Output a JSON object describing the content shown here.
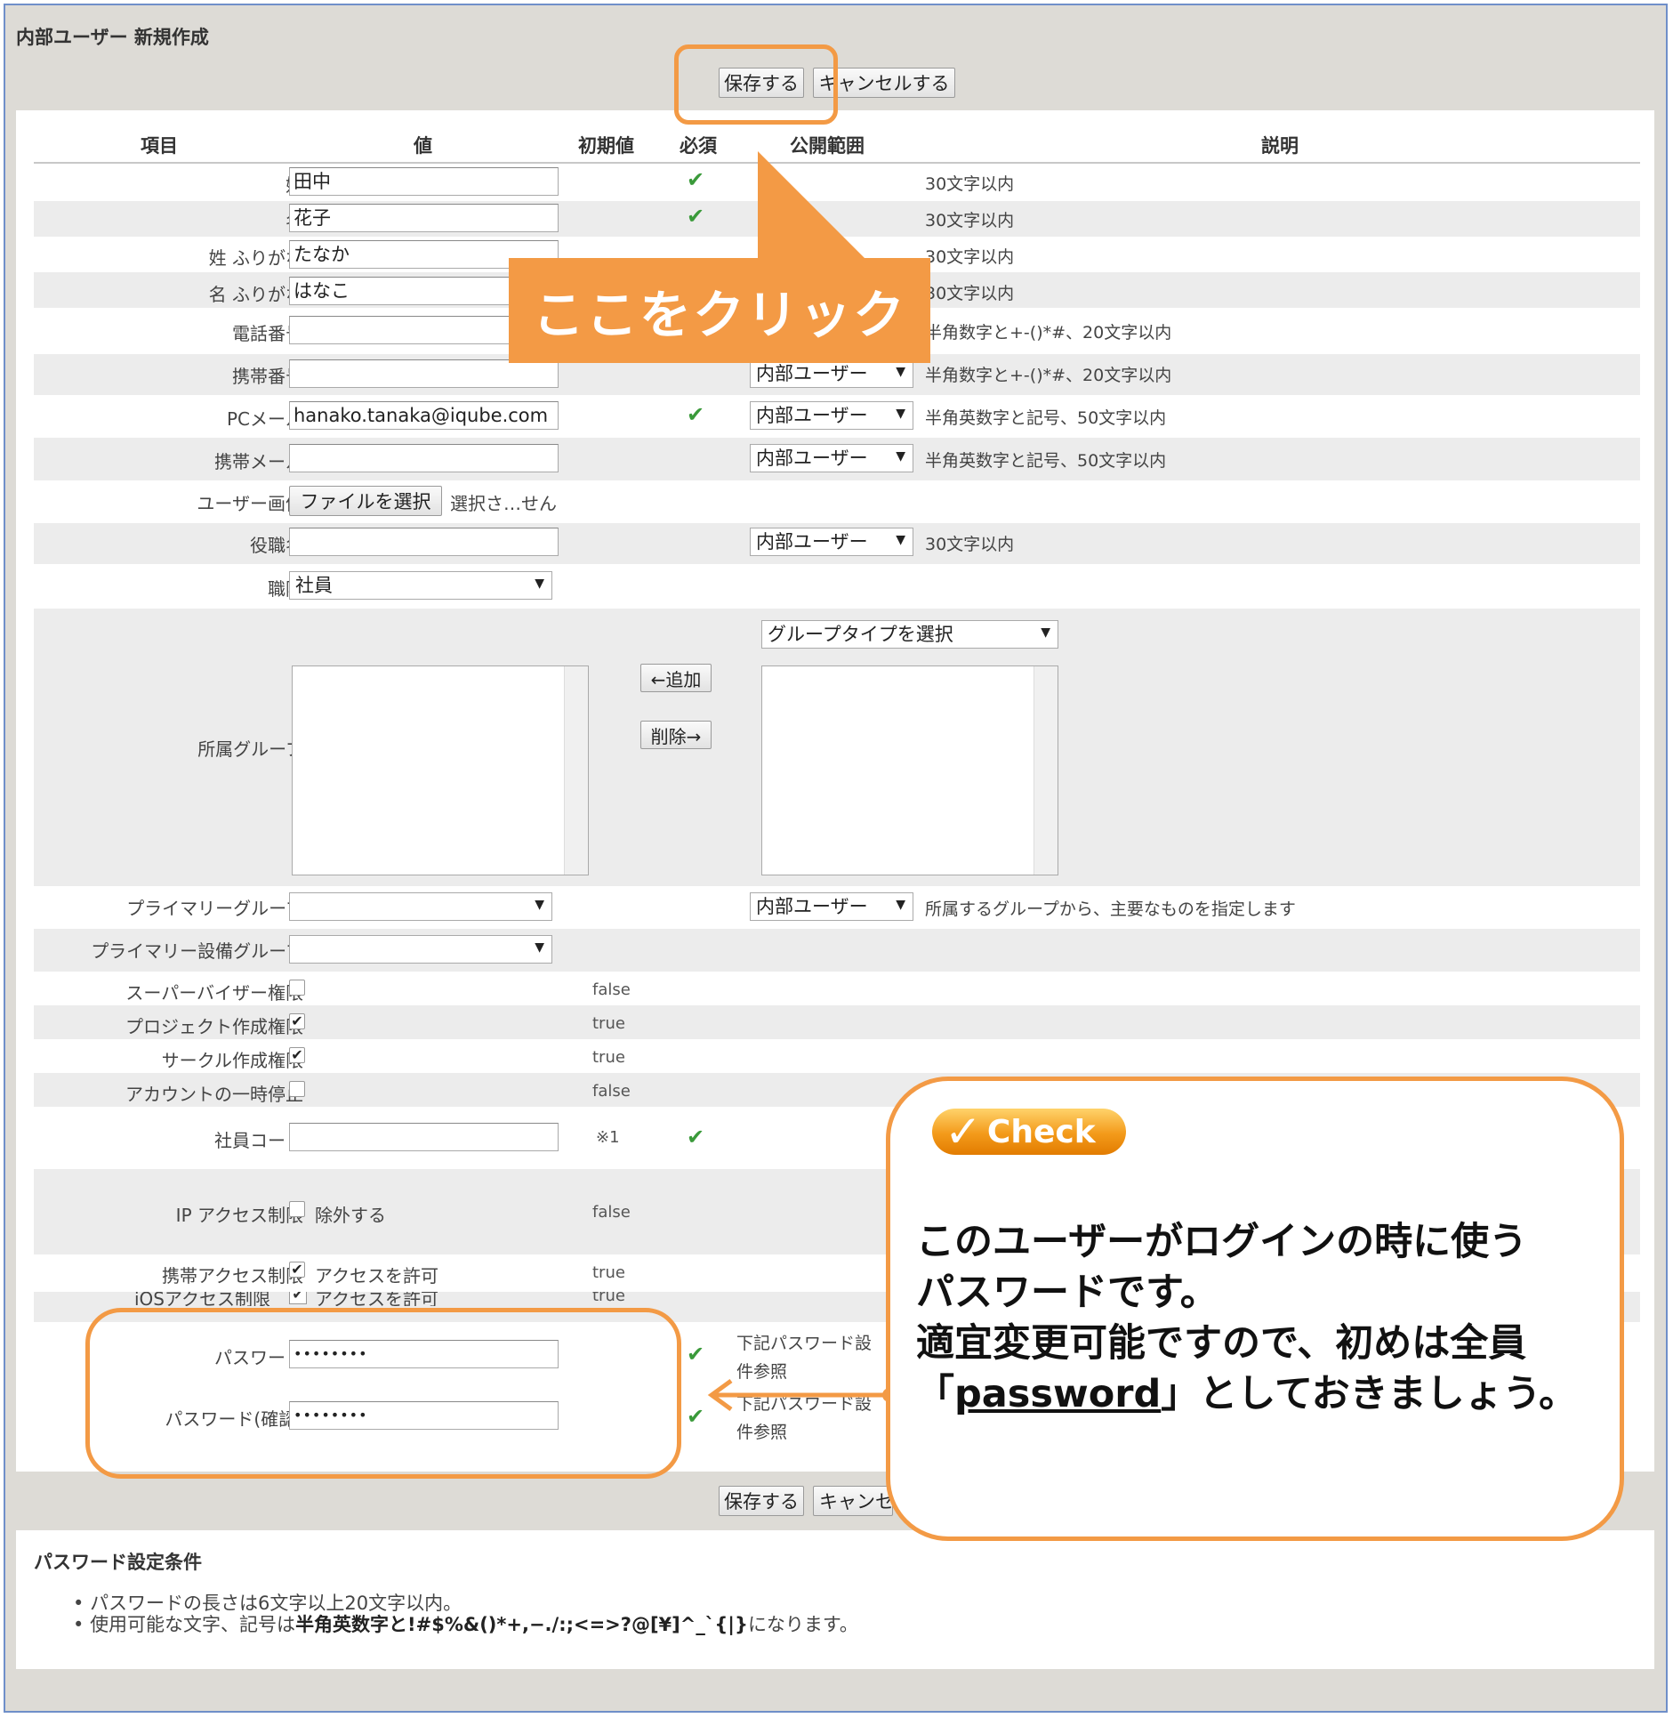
{
  "page": {
    "title": "内部ユーザー 新規作成"
  },
  "toolbar": {
    "save_label": "保存する",
    "cancel_label": "キャンセルする",
    "cancel_label_partial": "キャンセ"
  },
  "columns": {
    "item": "項目",
    "value": "値",
    "default": "初期値",
    "required": "必須",
    "visibility": "公開範囲",
    "description": "説明"
  },
  "fields": {
    "last_name": {
      "label": "姓",
      "value": "田中",
      "desc": "30文字以内"
    },
    "first_name": {
      "label": "名",
      "value": "花子",
      "desc": "30文字以内"
    },
    "last_name_kana": {
      "label": "姓 ふりがな",
      "value": "たなか",
      "desc": "30文字以内"
    },
    "first_name_kana": {
      "label": "名 ふりがな",
      "value": "はなこ",
      "desc": "30文字以内"
    },
    "phone": {
      "label": "電話番号",
      "value": "",
      "desc": "半角数字と+-()*#、20文字以内"
    },
    "mobile": {
      "label": "携帯番号",
      "value": "",
      "visibility": "内部ユーザー",
      "desc": "半角数字と+-()*#、20文字以内"
    },
    "pc_mail": {
      "label": "PCメール",
      "value": "hanako.tanaka@iqube.com",
      "visibility": "内部ユーザー",
      "desc": "半角英数字と記号、50文字以内"
    },
    "mobile_mail": {
      "label": "携帯メール",
      "value": "",
      "visibility": "内部ユーザー",
      "desc": "半角英数字と記号、50文字以内"
    },
    "user_image": {
      "label": "ユーザー画像",
      "button": "ファイルを選択",
      "status": "選択さ…せん"
    },
    "job_title": {
      "label": "役職名",
      "value": "",
      "visibility": "内部ユーザー",
      "desc": "30文字以内"
    },
    "rank": {
      "label": "職階",
      "value": "社員"
    },
    "groups": {
      "label": "所属グループ",
      "add": "←追加",
      "remove": "削除→",
      "type_select": "グループタイプを選択"
    },
    "primary_group": {
      "label": "プライマリーグループ",
      "value": "",
      "visibility": "内部ユーザー",
      "desc": "所属するグループから、主要なものを指定します"
    },
    "primary_facility_group": {
      "label": "プライマリー設備グループ",
      "value": ""
    },
    "supervisor": {
      "label": "スーパーバイザー権限",
      "default": "false"
    },
    "project_create": {
      "label": "プロジェクト作成権限",
      "default": "true"
    },
    "circle_create": {
      "label": "サークル作成権限",
      "default": "true"
    },
    "account_suspend": {
      "label": "アカウントの一時停止",
      "default": "false"
    },
    "employee_code": {
      "label": "社員コード",
      "default": "※1"
    },
    "ip_access": {
      "label": "IP アクセス制限",
      "option": "除外する",
      "default": "false"
    },
    "mobile_access": {
      "label": "携帯アクセス制限",
      "option": "アクセスを許可",
      "default": "true"
    },
    "ios_access": {
      "label": "iOSアクセス制限",
      "option": "アクセスを許可",
      "default": "true"
    },
    "password": {
      "label": "パスワード",
      "value": "••••••••",
      "desc1": "下記パスワード設",
      "desc2": "件参照"
    },
    "password_confirm": {
      "label": "パスワード(確認)",
      "value": "••••••••",
      "desc1": "下記パスワード設",
      "desc2": "件参照"
    }
  },
  "password_rules": {
    "title": "パスワード設定条件",
    "rule1": "パスワードの長さは6文字以上20文字以内。",
    "rule2_prefix": "使用可能な文字、記号は",
    "rule2_bold": "半角英数字と!#$%&()*+,−./:;<=>?@[¥]^_`{|}",
    "rule2_suffix": "になります。"
  },
  "annotations": {
    "click_here": "ここをクリック",
    "check_badge": "Check",
    "callout_line1": "このユーザーがログインの時に使う",
    "callout_line2": "パスワードです。",
    "callout_line3": "適宜変更可能ですので、初めは全員",
    "callout_line4_open": "「",
    "callout_line4_word": "password",
    "callout_line4_rest": "」としておきましょう。"
  },
  "icons": {
    "required": "check-mark-icon",
    "dropdown": "triangle-down-icon"
  },
  "colors": {
    "accent_orange": "#f39a45",
    "check_green": "#3a9a3a",
    "frame_blue": "#6f8fc9"
  }
}
